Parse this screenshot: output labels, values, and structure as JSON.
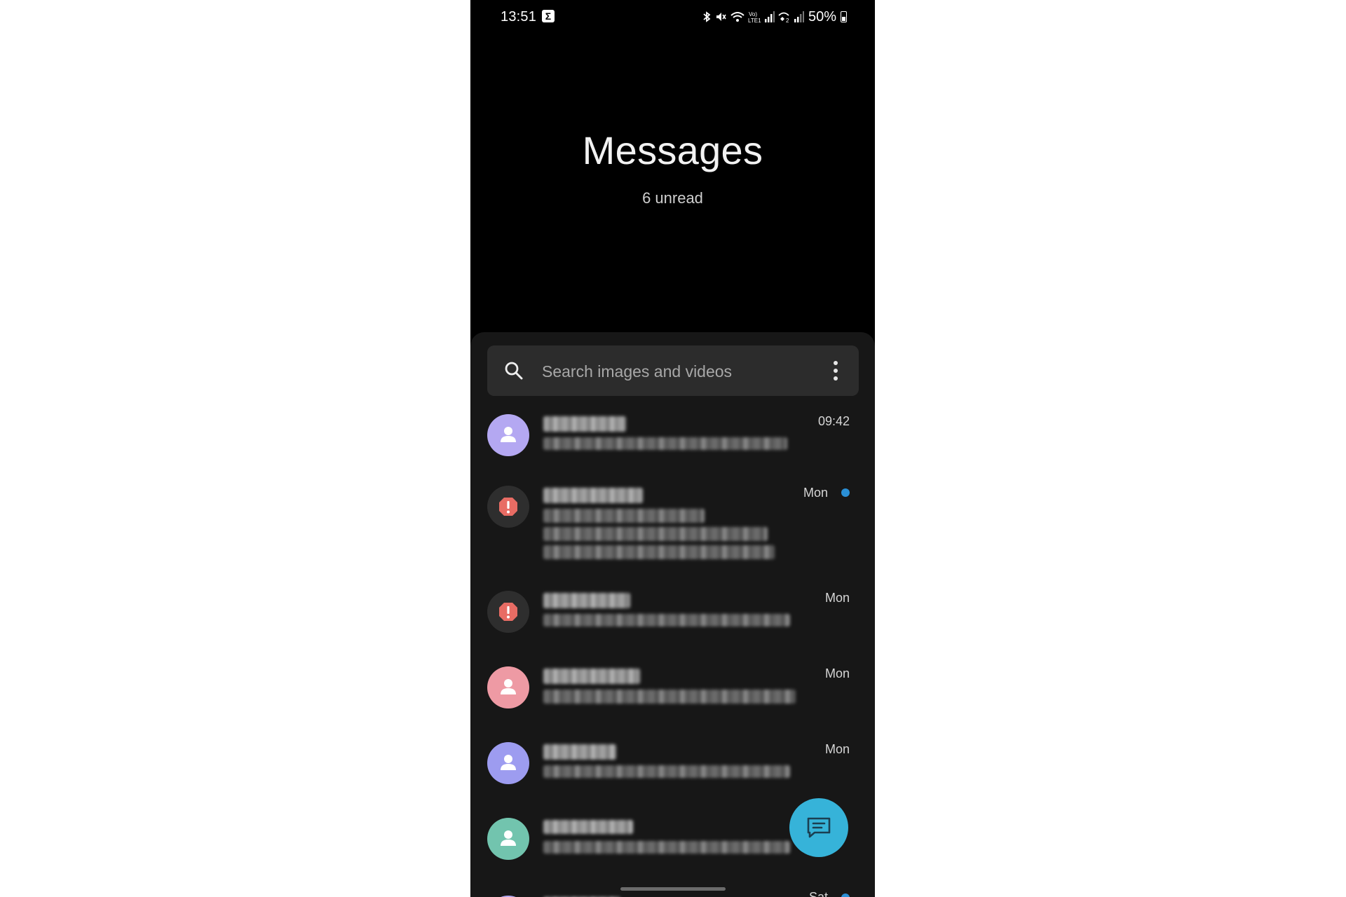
{
  "status_bar": {
    "time": "13:51",
    "app_icon": "Σ",
    "battery": "50%"
  },
  "header": {
    "title": "Messages",
    "subtitle": "6 unread"
  },
  "search": {
    "placeholder": "Search images and videos"
  },
  "conversations": [
    {
      "time": "09:42",
      "avatar": "person-icon",
      "avatar_color": "#b4a8f2",
      "unread": false
    },
    {
      "time": "Mon",
      "avatar": "spam-alert-icon",
      "avatar_color": "#e86c64",
      "unread": true
    },
    {
      "time": "Mon",
      "avatar": "spam-alert-icon",
      "avatar_color": "#e86c64",
      "unread": false
    },
    {
      "time": "Mon",
      "avatar": "person-icon",
      "avatar_color": "#ee9aa4",
      "unread": false
    },
    {
      "time": "Mon",
      "avatar": "person-icon",
      "avatar_color": "#9d9cf0",
      "unread": false
    },
    {
      "time": "",
      "avatar": "person-icon",
      "avatar_color": "#72c4ae",
      "unread": false
    },
    {
      "time": "Sat",
      "avatar": "person-icon",
      "avatar_color": "#b4a8f2",
      "unread": true
    }
  ],
  "colors": {
    "background": "#000000",
    "panel": "#171717",
    "search_bar": "#2c2c2c",
    "accent": "#36b3d9",
    "unread_dot": "#2a8fd6"
  }
}
